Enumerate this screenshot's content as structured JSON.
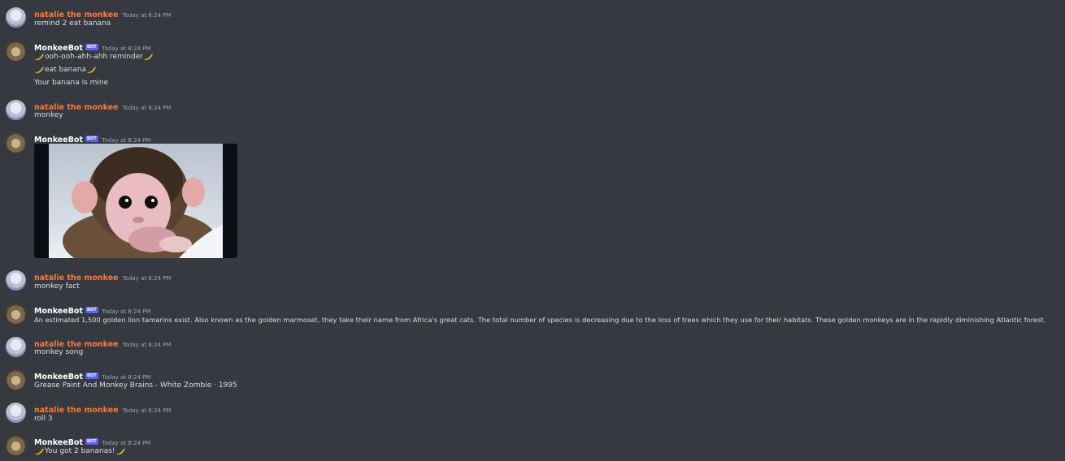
{
  "channel_messages": [
    {
      "author": "natalie the monkee",
      "role": "user",
      "timestamp": "Today at 8:24 PM",
      "lines": [
        "remind 2 eat banana"
      ]
    },
    {
      "author": "MonkeeBot",
      "role": "bot",
      "bot_tag": "BOT",
      "timestamp": "Today at 8:24 PM",
      "lines": [
        "ooh-ooh-ahh-ahh reminder",
        "eat banana",
        "Your banana is mine"
      ]
    },
    {
      "author": "natalie the monkee",
      "role": "user",
      "timestamp": "Today at 8:24 PM",
      "lines": [
        "monkey"
      ]
    },
    {
      "author": "MonkeeBot",
      "role": "bot",
      "bot_tag": "BOT",
      "timestamp": "Today at 8:24 PM",
      "image": "baby-monkey-photo"
    },
    {
      "author": "natalie the monkee",
      "role": "user",
      "timestamp": "Today at 8:24 PM",
      "lines": [
        "monkey fact"
      ]
    },
    {
      "author": "MonkeeBot",
      "role": "bot",
      "bot_tag": "BOT",
      "timestamp": "Today at 8:24 PM",
      "lines": [
        "An estimated 1,500 golden lion tamarins exist. Also known as the golden marmoset, they take their name from Africa's great cats. The total number of species is decreasing due to the loss of trees which they use for their habitats. These golden monkeys are in the rapidly diminishing Atlantic forest."
      ]
    },
    {
      "author": "natalie the monkee",
      "role": "user",
      "timestamp": "Today at 8:24 PM",
      "lines": [
        "monkey song"
      ]
    },
    {
      "author": "MonkeeBot",
      "role": "bot",
      "bot_tag": "BOT",
      "timestamp": "Today at 8:24 PM",
      "lines": [
        "Grease Paint And Monkey Brains - White Zombie · 1995"
      ]
    },
    {
      "author": "natalie the monkee",
      "role": "user",
      "timestamp": "Today at 8:24 PM",
      "lines": [
        "roll 3"
      ]
    },
    {
      "author": "MonkeeBot",
      "role": "bot",
      "bot_tag": "BOT",
      "timestamp": "Today at 8:24 PM",
      "lines": [
        "You got 2 bananas!"
      ]
    }
  ],
  "colors": {
    "background": "#36393f",
    "user_name": "#f47b3c",
    "bot_name": "#ffffff",
    "bot_tag": "#5865f2",
    "text": "#dcddde",
    "timestamp": "#a3a6aa"
  },
  "icons": {
    "banana": "banana-emoji-icon",
    "user_avatar": "user-avatar-icon",
    "bot_avatar": "bot-avatar-icon"
  }
}
